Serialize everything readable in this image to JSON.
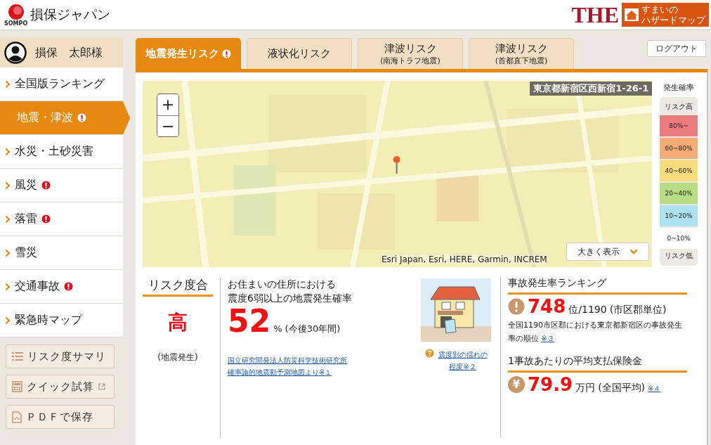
{
  "header": {
    "brand": "損保ジャパン",
    "brand_sub": "SOMPO",
    "product": "THE",
    "product_sub": [
      "すまいの",
      "ハザードマップ"
    ]
  },
  "user": {
    "name": "損保　太郎様"
  },
  "sidebar": {
    "items": [
      {
        "label": "全国版ランキング",
        "selected": false,
        "alert": false
      },
      {
        "label": "地震・津波",
        "selected": true,
        "alert": true
      },
      {
        "label": "水災・土砂災害",
        "selected": false,
        "alert": false
      },
      {
        "label": "風災",
        "selected": false,
        "alert": true
      },
      {
        "label": "落雷",
        "selected": false,
        "alert": true
      },
      {
        "label": "雪災",
        "selected": false,
        "alert": false
      },
      {
        "label": "交通事故",
        "selected": false,
        "alert": true
      },
      {
        "label": "緊急時マップ",
        "selected": false,
        "alert": false
      }
    ],
    "buttons": [
      {
        "label": "リスク度サマリ",
        "kind": "list"
      },
      {
        "label": "クイック試算",
        "kind": "calculator"
      },
      {
        "label": "ＰＤＦで保存",
        "kind": "pdf"
      }
    ]
  },
  "tabs": [
    {
      "label": "地震発生リスク",
      "selected": true,
      "alert": true
    },
    {
      "label": "液状化リスク",
      "selected": false,
      "alert": false
    },
    {
      "label": "津波リスク",
      "sub": "(南海トラフ地震)",
      "selected": false,
      "alert": false
    },
    {
      "label": "津波リスク",
      "sub": "(首都直下地震)",
      "selected": false,
      "alert": false
    }
  ],
  "logout": "ログアウト",
  "map": {
    "address": "東京都新宿区西新宿1-26-1",
    "zoom_in": "+",
    "zoom_out": "−",
    "attribution": "Esri Japan, Esri, HERE, Garmin, INCREM",
    "expand": "大きく表示"
  },
  "legend": {
    "title": "発生確率",
    "top": "リスク高",
    "bottom": "リスク低",
    "items": [
      {
        "label": "80%~",
        "color": "#ec7b7d"
      },
      {
        "label": "60~80%",
        "color": "#f6ab72"
      },
      {
        "label": "40~60%",
        "color": "#f8dc7c"
      },
      {
        "label": "20~40%",
        "color": "#b8dc82"
      },
      {
        "label": "10~20%",
        "color": "#ace2f0"
      },
      {
        "label": "0~10%",
        "color": "#ffffff"
      }
    ]
  },
  "risk": {
    "title": "リスク度合",
    "level": "高",
    "note": "(地震発生)"
  },
  "probability": {
    "lines": [
      "お住まいの住所における",
      "震度6弱以上の地震発生確率"
    ],
    "value": "52",
    "unit": "%",
    "period": "(今後30年間)",
    "source": [
      "国立研究開発法人防災科学技術研究所",
      "確率論的地震動予測地図より※１"
    ]
  },
  "illustration": {
    "link": [
      "震度別の揺れの",
      "程度※２"
    ]
  },
  "ranking": {
    "title": "事故発生率ランキング",
    "rank": "748",
    "rank_unit": "位/1190",
    "rank_scope": "(市区郡単位)",
    "desc": "全国1190市区郡における東京都新宿区の事故発生率の順位",
    "note": "※３"
  },
  "payout": {
    "title": "1事故あたりの平均支払保険金",
    "symbol": "¥",
    "value": "79.9",
    "unit": "万円",
    "scope": "(全国平均)",
    "note": "※４"
  }
}
